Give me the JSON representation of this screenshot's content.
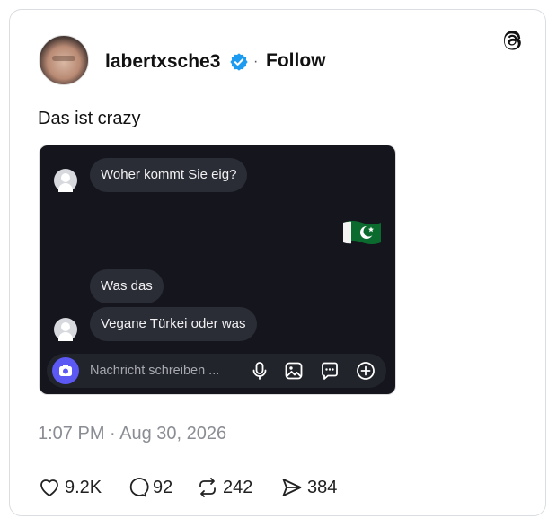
{
  "post": {
    "username": "labertxsche3",
    "separator": "·",
    "follow_label": "Follow",
    "text": "Das ist crazy",
    "timestamp": "1:07 PM · Aug 30, 2026"
  },
  "chat": {
    "messages": [
      {
        "text": "Woher kommt Sie eig?"
      },
      {
        "text": "Was das"
      },
      {
        "text": "Vegane Türkei oder was"
      }
    ],
    "compose_placeholder": "Nachricht schreiben ..."
  },
  "stats": {
    "likes": "9.2K",
    "replies": "92",
    "reposts": "242",
    "shares": "384"
  },
  "colors": {
    "verified": "#1d9bf0",
    "chat_bg": "#15161d",
    "bubble": "#2b2d36",
    "camera_button": "#5b58f4",
    "text_muted": "#8a8d93"
  },
  "icons": {
    "brand": "threads-icon",
    "verified": "verified-badge-icon",
    "like": "heart-icon",
    "reply": "comment-icon",
    "repost": "repost-icon",
    "share": "send-icon"
  }
}
